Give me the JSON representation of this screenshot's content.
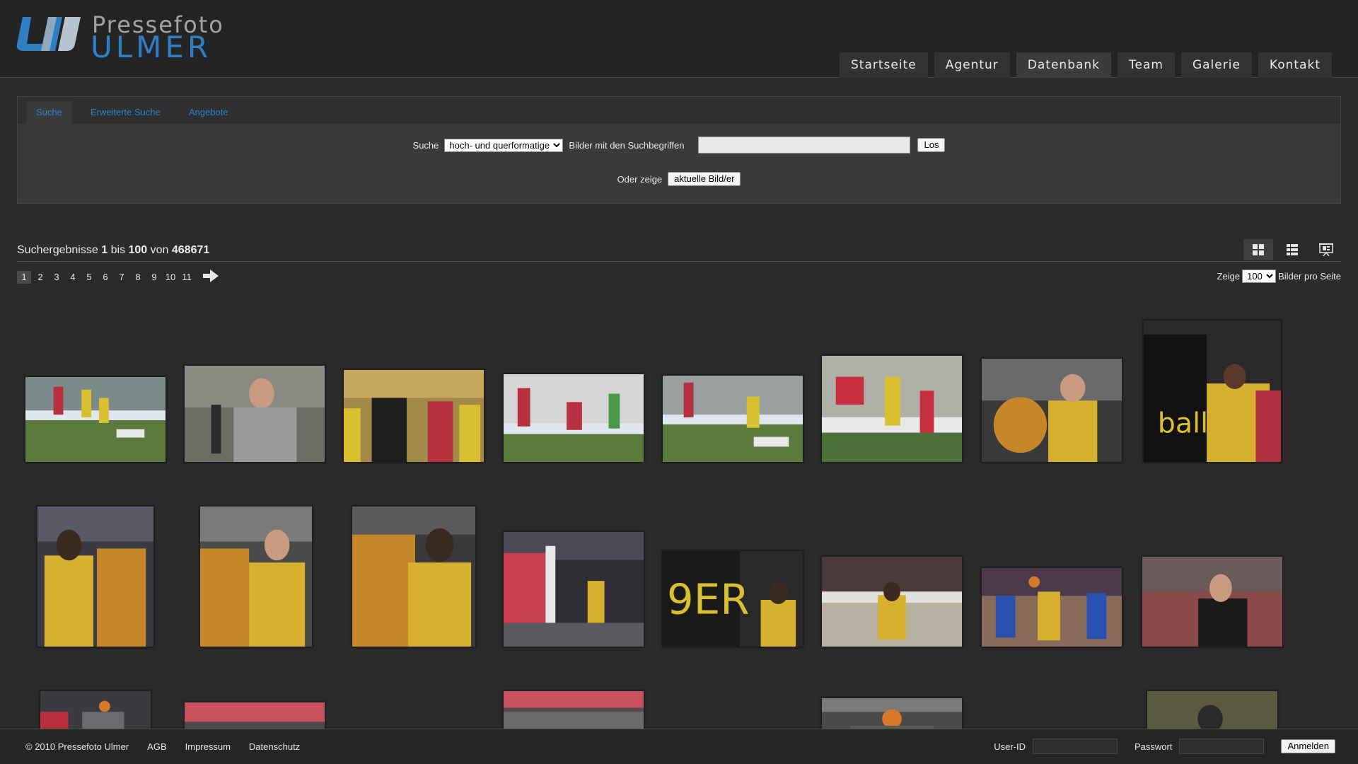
{
  "logo": {
    "line1": "Pressefoto",
    "line2": "ULMER",
    "colors": {
      "top": "#9fa3a8",
      "bottom": "#2f7fc4"
    }
  },
  "nav": {
    "items": [
      {
        "label": "Startseite",
        "active": false
      },
      {
        "label": "Agentur",
        "active": false
      },
      {
        "label": "Datenbank",
        "active": true
      },
      {
        "label": "Team",
        "active": false
      },
      {
        "label": "Galerie",
        "active": false
      },
      {
        "label": "Kontakt",
        "active": false
      }
    ]
  },
  "search": {
    "tabs": [
      {
        "label": "Suche",
        "active": true
      },
      {
        "label": "Erweiterte Suche",
        "active": false
      },
      {
        "label": "Angebote",
        "active": false
      }
    ],
    "label_suche": "Suche",
    "format_selected": "hoch- und querformatige",
    "label_terms": "Bilder mit den Suchbegriffen",
    "query_value": "",
    "go_button": "Los",
    "or_label": "Oder zeige",
    "current_button": "aktuelle Bild/er"
  },
  "results": {
    "prefix": "Suchergebnisse",
    "from": "1",
    "mid1": "bis",
    "to": "100",
    "mid2": "von",
    "total": "468671"
  },
  "view_modes": [
    {
      "icon": "grid-view-icon",
      "active": true
    },
    {
      "icon": "list-view-icon",
      "active": false
    },
    {
      "icon": "slideshow-icon",
      "active": false
    }
  ],
  "pagination": {
    "pages": [
      "1",
      "2",
      "3",
      "4",
      "5",
      "6",
      "7",
      "8",
      "9",
      "10",
      "11"
    ],
    "current": "1",
    "next_icon": "arrow-right-icon"
  },
  "per_page": {
    "label_before": "Zeige",
    "selected": "100",
    "label_after": "Bilder pro Seite"
  },
  "footer": {
    "copyright": "© 2010 Pressefoto Ulmer",
    "links": [
      "AGB",
      "Impressum",
      "Datenschutz"
    ],
    "userid_label": "User-ID",
    "password_label": "Passwort",
    "login_button": "Anmelden"
  },
  "thumbnails": [
    {
      "subject": "football match action, white-red vs yellow team"
    },
    {
      "subject": "football player in grey shirt"
    },
    {
      "subject": "referee red card scene"
    },
    {
      "subject": "football players in front of goal"
    },
    {
      "subject": "football match action, player on ground"
    },
    {
      "subject": "football header duel"
    },
    {
      "subject": "basketball player with tiger mascot"
    },
    {
      "subject": "basketball player celebrating with fans"
    },
    {
      "subject": "basketball player with tiger mascot"
    },
    {
      "subject": "basketball player with tiger mascot"
    },
    {
      "subject": "basketball player hugging tiger mascot"
    },
    {
      "subject": "basketball player near fans"
    },
    {
      "subject": "basketball player high-fiving fans"
    },
    {
      "subject": "basketball player on court"
    },
    {
      "subject": "basketball game action"
    },
    {
      "subject": "basketball coach"
    },
    {
      "subject": "basketball game shot"
    },
    {
      "subject": "basketball arena crowd"
    },
    {
      "subject": "basketball arena crowd"
    },
    {
      "subject": "basketball player shooting"
    },
    {
      "subject": "basketball coach on sideline"
    }
  ]
}
